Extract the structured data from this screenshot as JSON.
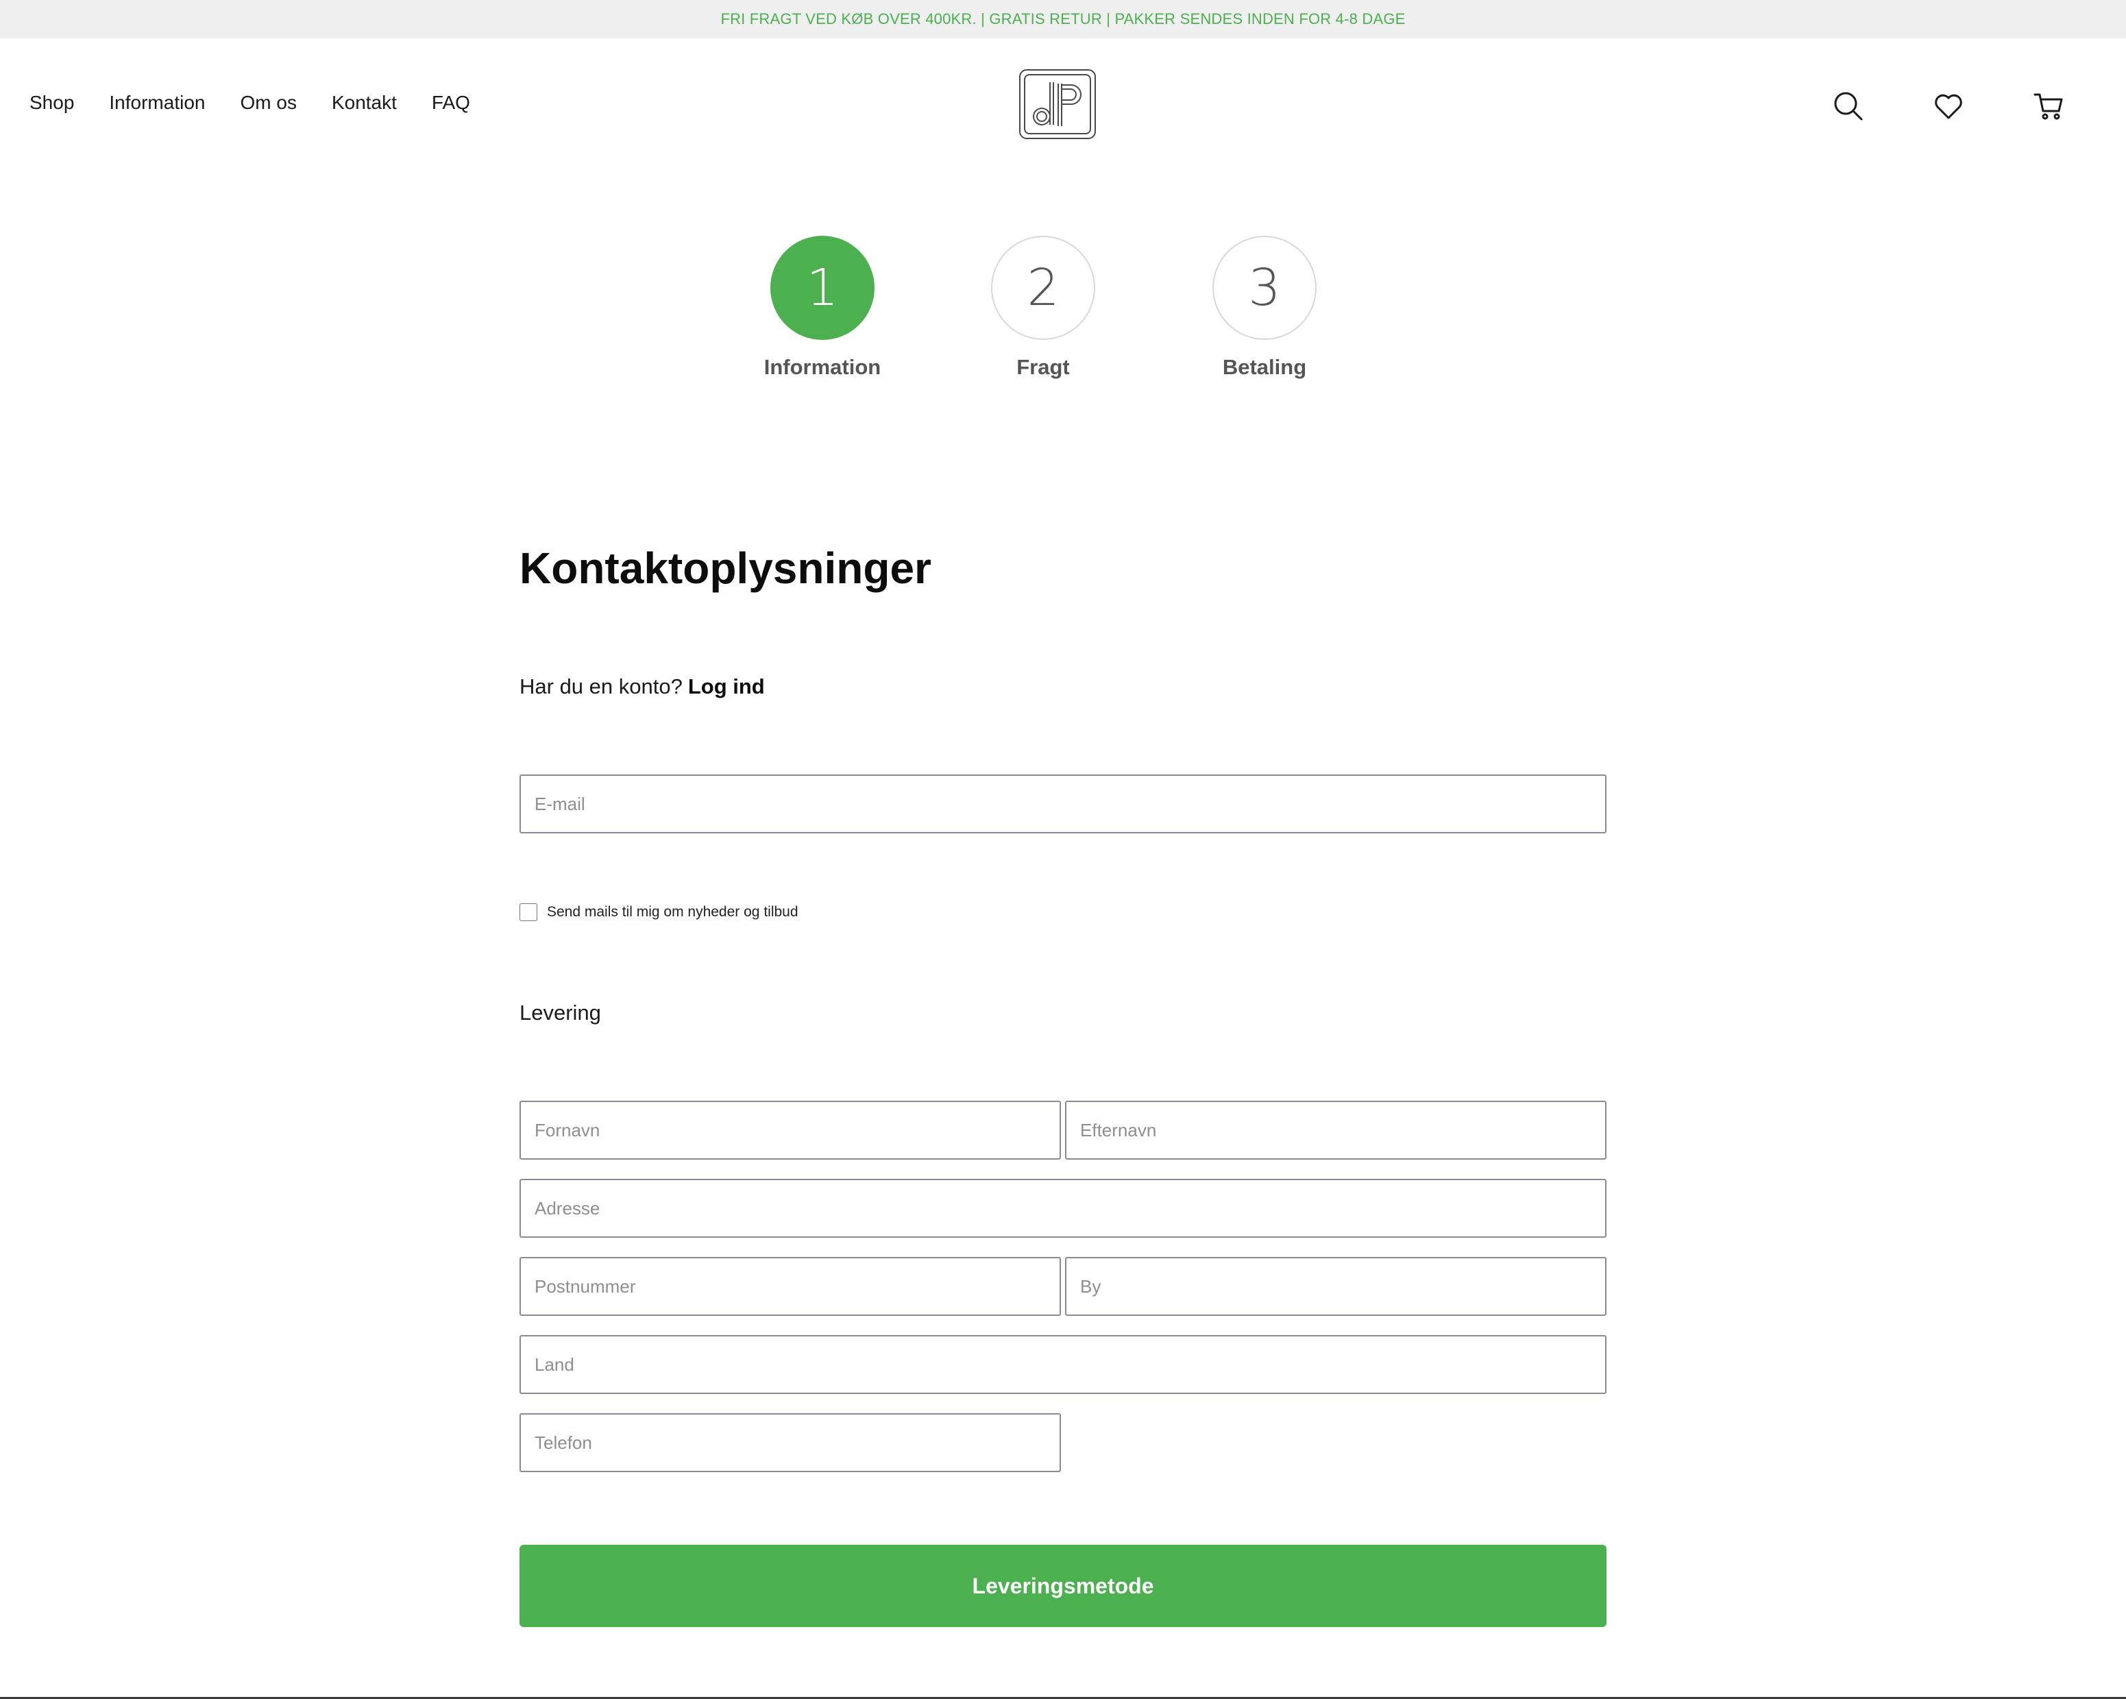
{
  "announcement": "FRI FRAGT VED KØB OVER 400KR. | GRATIS RETUR | PAKKER SENDES INDEN FOR 4-8 DAGE",
  "nav": {
    "items": [
      {
        "label": "Shop"
      },
      {
        "label": "Information"
      },
      {
        "label": "Om os"
      },
      {
        "label": "Kontakt"
      },
      {
        "label": "FAQ"
      }
    ]
  },
  "header": {
    "logo_icon": "dp-monogram-logo",
    "icons": [
      "search-icon",
      "heart-icon",
      "cart-icon"
    ]
  },
  "steps": [
    {
      "number": "1",
      "label": "Information",
      "state": "active"
    },
    {
      "number": "2",
      "label": "Fragt",
      "state": "inactive"
    },
    {
      "number": "3",
      "label": "Betaling",
      "state": "inactive"
    }
  ],
  "contact": {
    "title": "Kontaktoplysninger",
    "account_prompt": "Har du en konto?",
    "login_label": "Log ind",
    "email_placeholder": "E-mail",
    "newsletter_label": "Send mails til mig om nyheder og tilbud",
    "newsletter_checked": false
  },
  "delivery": {
    "section_label": "Levering",
    "firstname_placeholder": "Fornavn",
    "lastname_placeholder": "Efternavn",
    "address_placeholder": "Adresse",
    "postal_placeholder": "Postnummer",
    "city_placeholder": "By",
    "country_placeholder": "Land",
    "phone_placeholder": "Telefon"
  },
  "submit_label": "Leveringsmetode",
  "colors": {
    "accent": "#4caf50",
    "announcement_bg": "#efefef",
    "field_border": "#8a8a96"
  }
}
